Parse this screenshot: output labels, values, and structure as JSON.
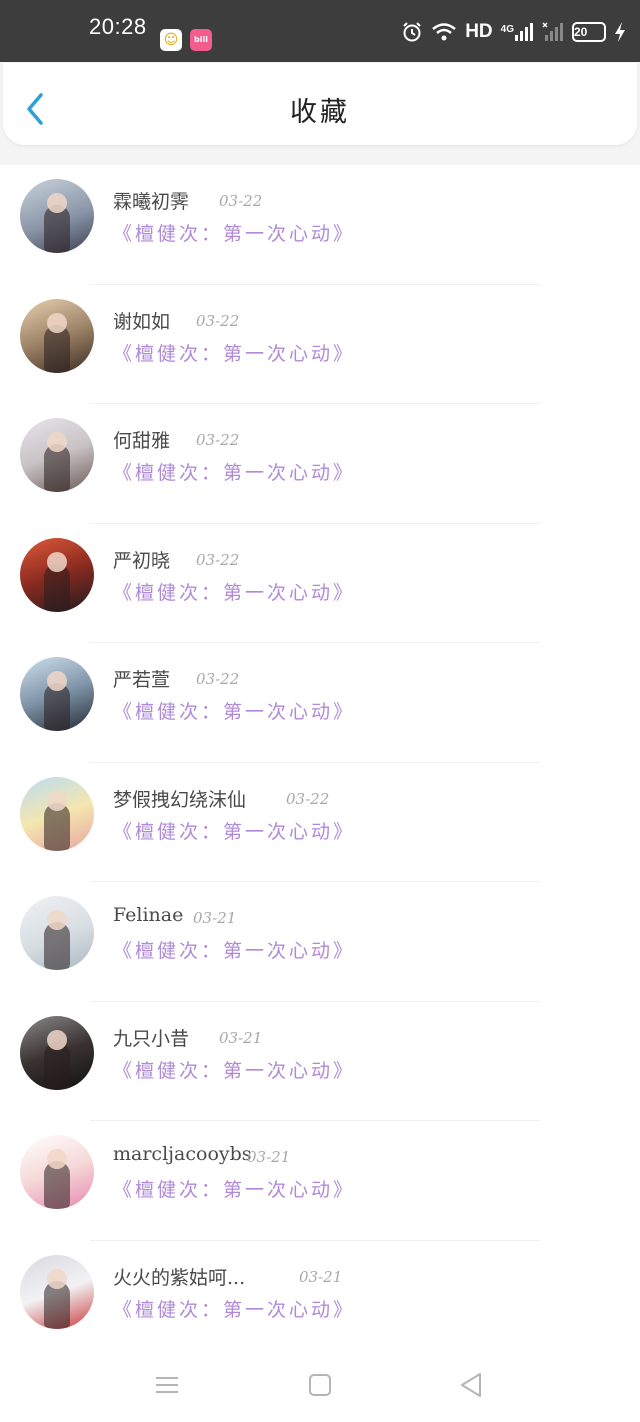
{
  "status_bar": {
    "time": "20:28",
    "app_icon_1": "QQ",
    "app_icon_2": "bilibili",
    "hd_label": "HD",
    "network_label": "4G",
    "battery": "20",
    "icons": [
      "alarm-icon",
      "wifi-icon",
      "signal-icon",
      "signal-no-service-icon",
      "battery-icon",
      "charging-icon"
    ]
  },
  "header": {
    "title": "收藏",
    "back_icon": "chevron-left-icon",
    "accent_color": "#2e9fd9"
  },
  "colors": {
    "name": "#4a4a4a",
    "date": "#a8a8a8",
    "content": "#b08ad8"
  },
  "favorites": [
    {
      "name": "霖曦初霁",
      "date": "03-22",
      "content": "《檀健次：第一次心动》"
    },
    {
      "name": "谢如如",
      "date": "03-22",
      "content": "《檀健次：第一次心动》"
    },
    {
      "name": "何甜雅",
      "date": "03-22",
      "content": "《檀健次：第一次心动》"
    },
    {
      "name": "严初晓",
      "date": "03-22",
      "content": "《檀健次：第一次心动》"
    },
    {
      "name": "严若萱",
      "date": "03-22",
      "content": "《檀健次：第一次心动》"
    },
    {
      "name": "梦假拽幻绕沫仙",
      "date": "03-22",
      "content": "《檀健次：第一次心动》"
    },
    {
      "name": "Felinae",
      "date": "03-21",
      "content": "《檀健次：第一次心动》"
    },
    {
      "name": "九只小昔",
      "date": "03-21",
      "content": "《檀健次：第一次心动》"
    },
    {
      "name": "marcljacooybs",
      "date": "03-21",
      "content": "《檀健次：第一次心动》"
    },
    {
      "name": "火火的紫姑呵...",
      "date": "03-21",
      "content": "《檀健次：第一次心动》"
    }
  ],
  "nav_bar": {
    "icons": [
      "menu-icon",
      "home-square-icon",
      "back-triangle-icon"
    ]
  }
}
